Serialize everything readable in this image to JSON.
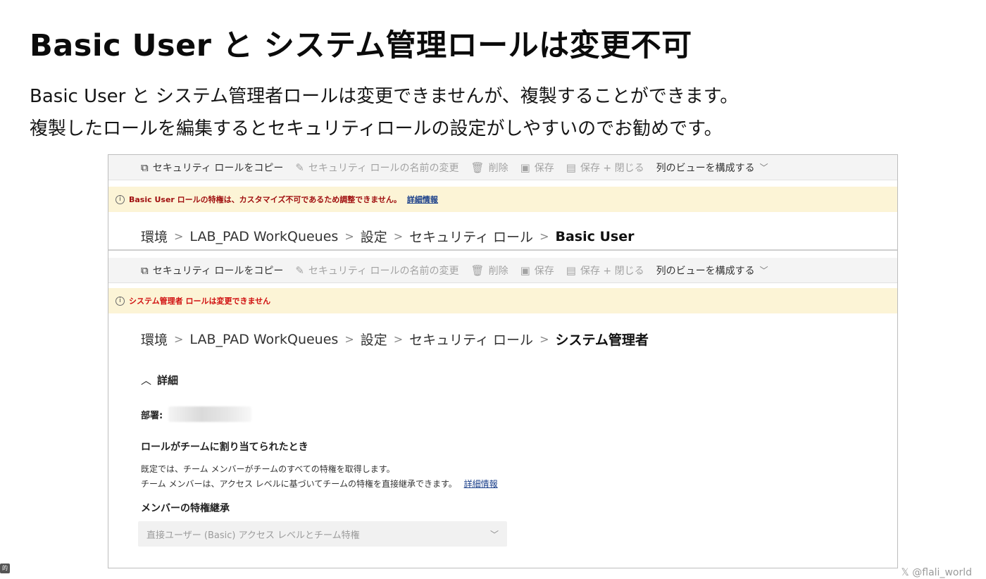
{
  "slide": {
    "title": "Basic User と システム管理ロールは変更不可",
    "desc_line1": "Basic User と システム管理者ロールは変更できませんが、複製することができます。",
    "desc_line2": "複製したロールを編集するとセキュリティロールの設定がしやすいのでお勧めです。",
    "watermark": "𝕏 @flali_world",
    "corner_badge": "的"
  },
  "toolbar": {
    "copy_label": "セキュリティ ロールをコピー",
    "rename_label": "セキュリティ ロールの名前の変更",
    "delete_label": "削除",
    "save_label": "保存",
    "save_close_label": "保存 + 閉じる",
    "configure_view_label": "列のビューを構成する",
    "icons": {
      "copy": "copy-icon",
      "rename": "pencil-icon",
      "delete": "trash-icon",
      "save": "save-icon",
      "save_close": "save-close-icon",
      "chevron": "chevron-down-icon"
    }
  },
  "panel1": {
    "message": "Basic User ロールの特権は、カスタマイズ不可であるため調整できません。",
    "message_link": "詳細情報",
    "breadcrumb": [
      "環境",
      "LAB_PAD WorkQueues",
      "設定",
      "セキュリティ ロール",
      "Basic User"
    ]
  },
  "panel2": {
    "message": "システム管理者 ロールは変更できません",
    "breadcrumb": [
      "環境",
      "LAB_PAD WorkQueues",
      "設定",
      "セキュリティ ロール",
      "システム管理者"
    ],
    "details_header": "詳細",
    "business_unit_label": "部署:",
    "team_heading": "ロールがチームに割り当てられたとき",
    "team_text_line1": "既定では、チーム メンバーがチームのすべての特権を取得します。",
    "team_text_line2": "チーム メンバーは、アクセス レベルに基づいてチームの特権を直接継承できます。",
    "team_text_link": "詳細情報",
    "inherit_label": "メンバーの特権継承",
    "inherit_value": "直接ユーザー (Basic) アクセス レベルとチーム特権"
  },
  "colors": {
    "message_bg": "#fcf4d6",
    "message_text": "#a01010",
    "link": "#1a3f8a",
    "toolbar_bg": "#f4f4f4"
  }
}
